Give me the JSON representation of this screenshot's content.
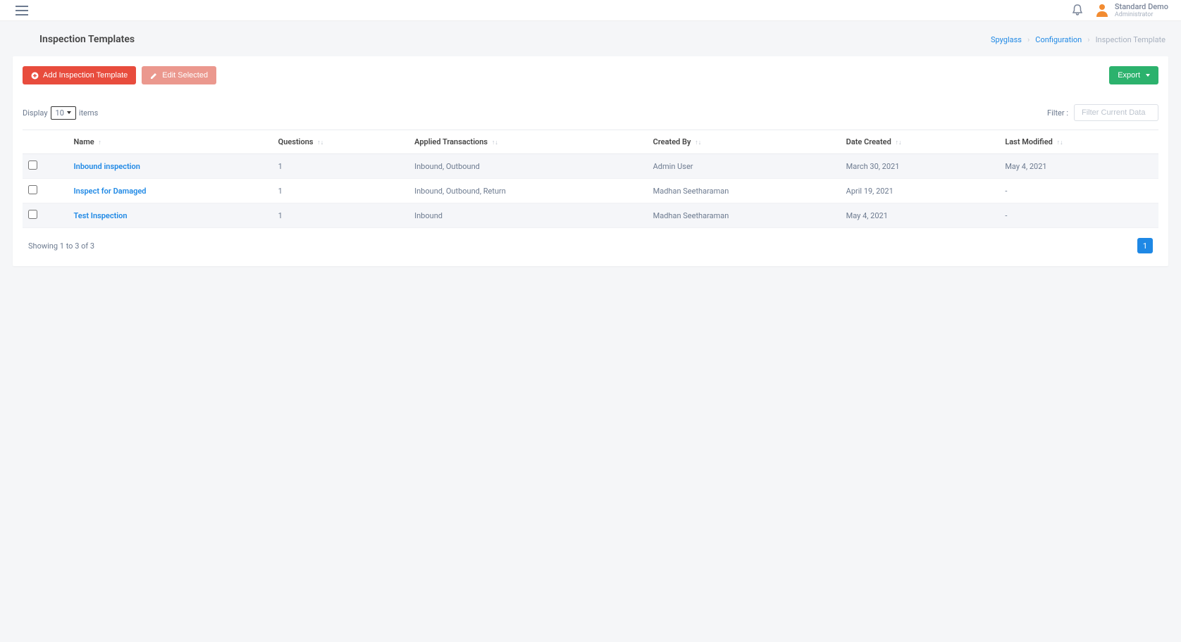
{
  "header": {
    "user_name": "Standard Demo",
    "user_role": "Administrator"
  },
  "page": {
    "title": "Inspection Templates"
  },
  "breadcrumb": {
    "root": "Spyglass",
    "config": "Configuration",
    "current": "Inspection Template"
  },
  "toolbar": {
    "add_label": "Add Inspection Template",
    "edit_label": "Edit Selected",
    "export_label": "Export"
  },
  "display": {
    "label_pre": "Display",
    "value": "10",
    "label_post": "items"
  },
  "filter": {
    "label": "Filter :",
    "placeholder": "Filter Current Data"
  },
  "table": {
    "headers": {
      "name": "Name",
      "questions": "Questions",
      "applied": "Applied Transactions",
      "created_by": "Created By",
      "date_created": "Date Created",
      "last_modified": "Last Modified"
    },
    "rows": [
      {
        "name": "Inbound inspection",
        "questions": "1",
        "applied": "Inbound, Outbound",
        "created_by": "Admin User",
        "date_created": "March 30, 2021",
        "last_modified": "May 4, 2021"
      },
      {
        "name": "Inspect for Damaged",
        "questions": "1",
        "applied": "Inbound, Outbound, Return",
        "created_by": "Madhan Seetharaman",
        "date_created": "April 19, 2021",
        "last_modified": "-"
      },
      {
        "name": "Test Inspection",
        "questions": "1",
        "applied": "Inbound",
        "created_by": "Madhan Seetharaman",
        "date_created": "May 4, 2021",
        "last_modified": "-"
      }
    ]
  },
  "footer": {
    "showing": "Showing 1 to 3 of 3",
    "page": "1"
  }
}
